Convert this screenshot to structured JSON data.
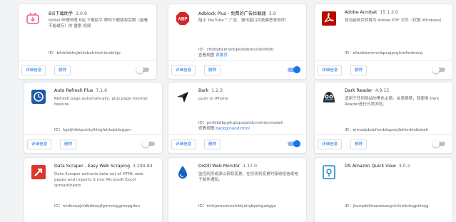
{
  "extensions": [
    {
      "name": "Bili下载助手",
      "version": "2.0.9",
      "description": "bilibili 哔哩哔哩 B站 下载助手 帮你下载版权受限（能看不能缓存）的 番剧 视频",
      "id_line": "ID：bfcbfobhcjbkilcbehlnlchiinoklkjp",
      "view_prefix": "",
      "view_link": "",
      "details_label": "详细信息",
      "remove_label": "删除",
      "enabled": false
    },
    {
      "name": "Adblock Plus - 免费的广告拦截器",
      "version": "3.9",
      "description": "阻止 YouTube™ 广告、弹出窗口并抵御恶意软件！",
      "id_line": "ID：cfhdojbkjhnklbpkdaibdccddilifddb",
      "view_prefix": "查看视图",
      "view_link": "背景页",
      "details_label": "详细信息",
      "remove_label": "删除",
      "enabled": true
    },
    {
      "name": "Adobe Acrobat",
      "version": "15.1.2.0",
      "description": "将当前网页转换为 Adobe PDF 文件（仅限 Windows）",
      "id_line": "ID：efaidnbmnnnibpcajpcglclefindmkaj",
      "view_prefix": "",
      "view_link": "",
      "details_label": "详细信息",
      "remove_label": "删除",
      "enabled": false
    },
    {
      "name": "Auto Refresh Plus",
      "version": "7.1.6",
      "description": "Refresh page automatically, plus page monitor feature.",
      "id_line": "ID：hgeljhfekpckiiplhkigfehkdpldcggm",
      "view_prefix": "",
      "view_link": "",
      "details_label": "详细信息",
      "remove_label": "删除",
      "enabled": false
    },
    {
      "name": "Bark",
      "version": "1.2.3",
      "description": "push to iPhone",
      "id_line": "ID：pmlkbdbpglkgbgopghdcmohdcmladeii",
      "view_prefix": "查看视图",
      "view_link": "background.html",
      "details_label": "详细信息",
      "remove_label": "删除",
      "enabled": true
    },
    {
      "name": "Dark Reader",
      "version": "4.9.15",
      "description": "适用于任何网站的黑色主题。关爱眼睛，就使用 Dark Reader进行日常浏览。",
      "id_line": "ID：eimadpbcbfnmbkopoojfekhnkhdbieeh",
      "view_prefix": "",
      "view_link": "",
      "details_label": "详细信息",
      "remove_label": "删除",
      "enabled": false
    },
    {
      "name": "Data Scraper - Easy Web Scraping",
      "version": "3.299.84",
      "description": "Data Scraper extracts data out of HTML web pages and imports it into Microsoft Excel spreadsheets",
      "id_line": "ID：nndknepjnldbdbepjfgmncbggmopgden",
      "view_prefix": "",
      "view_link": "",
      "details_label": "详细信息",
      "remove_label": "删除",
      "enabled": false
    },
    {
      "name": "Distill Web Monitor",
      "version": "1.17.0",
      "description": "监控网页或源以获取变更。在侦测到变更时接收短信或电子邮件通知。",
      "id_line": "ID：inlikjemeeknofckkjolnjbpehgadgge",
      "view_prefix": "",
      "view_link": "",
      "details_label": "详细信息",
      "remove_label": "删除",
      "enabled": false
    },
    {
      "name": "DS Amazon Quick View",
      "version": "3.0.2",
      "description": "",
      "id_line": "ID：jkompbllimaoekaogchhkmkdogpkhojg",
      "view_prefix": "",
      "view_link": "",
      "details_label": "详细信息",
      "remove_label": "删除",
      "enabled": false
    }
  ],
  "icons": [
    "bili-download-icon",
    "adblock-plus-icon",
    "adobe-acrobat-icon",
    "auto-refresh-icon",
    "bark-icon",
    "dark-reader-icon",
    "data-scraper-icon",
    "distill-icon",
    "amazon-quick-view-icon"
  ],
  "colors": {
    "accent": "#1a73e8",
    "toggle_on_track": "#8ab4f8",
    "toggle_off_track": "#bdc1c6",
    "adblock_red": "#d4262c",
    "acrobat_red": "#b30b00",
    "data_scraper_red": "#d9372b",
    "distill_blue": "#1565c0"
  }
}
